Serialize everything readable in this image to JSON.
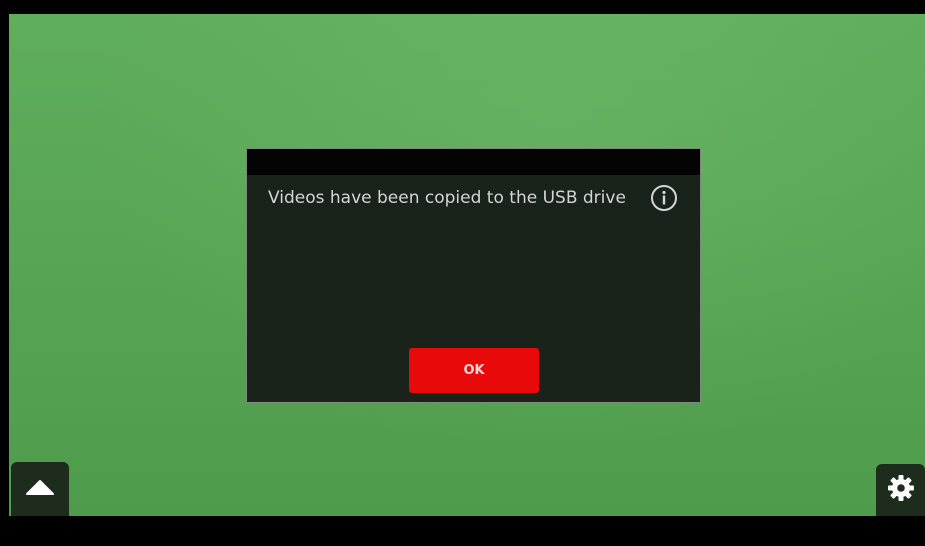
{
  "dialog": {
    "message": "Videos have been copied to the USB drive",
    "ok_label": "OK",
    "info_icon": "info-icon"
  },
  "controls": {
    "menu_icon": "triangle-up-icon",
    "settings_icon": "gear-icon"
  },
  "colors": {
    "background_green": "#58a655",
    "dialog_bg": "#1a2319",
    "dialog_header": "#030403",
    "ok_button": "#e80a0a",
    "side_button_bg": "#1d2c1d"
  }
}
